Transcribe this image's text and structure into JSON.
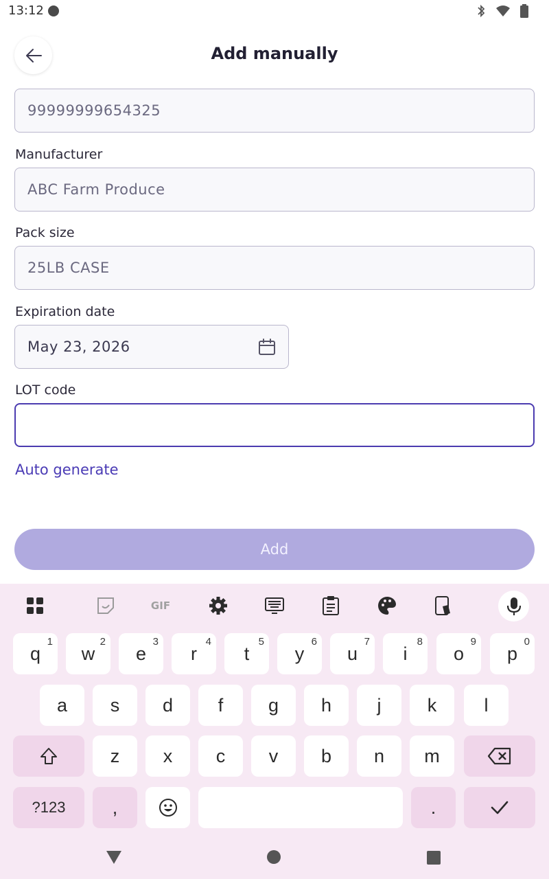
{
  "status_bar": {
    "time": "13:12"
  },
  "header": {
    "title": "Add manually"
  },
  "form": {
    "barcode_value": "99999999654325",
    "manufacturer_label": "Manufacturer",
    "manufacturer_value": "ABC Farm Produce",
    "pack_size_label": "Pack size",
    "pack_size_value": "25LB CASE",
    "expiration_label": "Expiration date",
    "expiration_value": "May 23, 2026",
    "lot_label": "LOT code",
    "lot_value": "",
    "auto_generate_label": "Auto generate",
    "add_button_label": "Add"
  },
  "keyboard": {
    "toolbar_icons": [
      "apps-icon",
      "sticker-icon",
      "gif-icon",
      "settings-icon",
      "keyboard-icon",
      "clipboard-icon",
      "palette-icon",
      "translate-icon",
      "mic-icon"
    ],
    "gif_label": "GIF",
    "row1": [
      {
        "k": "q",
        "s": "1"
      },
      {
        "k": "w",
        "s": "2"
      },
      {
        "k": "e",
        "s": "3"
      },
      {
        "k": "r",
        "s": "4"
      },
      {
        "k": "t",
        "s": "5"
      },
      {
        "k": "y",
        "s": "6"
      },
      {
        "k": "u",
        "s": "7"
      },
      {
        "k": "i",
        "s": "8"
      },
      {
        "k": "o",
        "s": "9"
      },
      {
        "k": "p",
        "s": "0"
      }
    ],
    "row2": [
      "a",
      "s",
      "d",
      "f",
      "g",
      "h",
      "j",
      "k",
      "l"
    ],
    "row3": [
      "z",
      "x",
      "c",
      "v",
      "b",
      "n",
      "m"
    ],
    "symbols_label": "?123",
    "comma_label": ",",
    "period_label": "."
  },
  "colors": {
    "accent": "#4a3bb5",
    "add_button_disabled": "#b0aadf",
    "keyboard_bg": "#f7e9f4",
    "key_alt": "#f0d6ea"
  }
}
